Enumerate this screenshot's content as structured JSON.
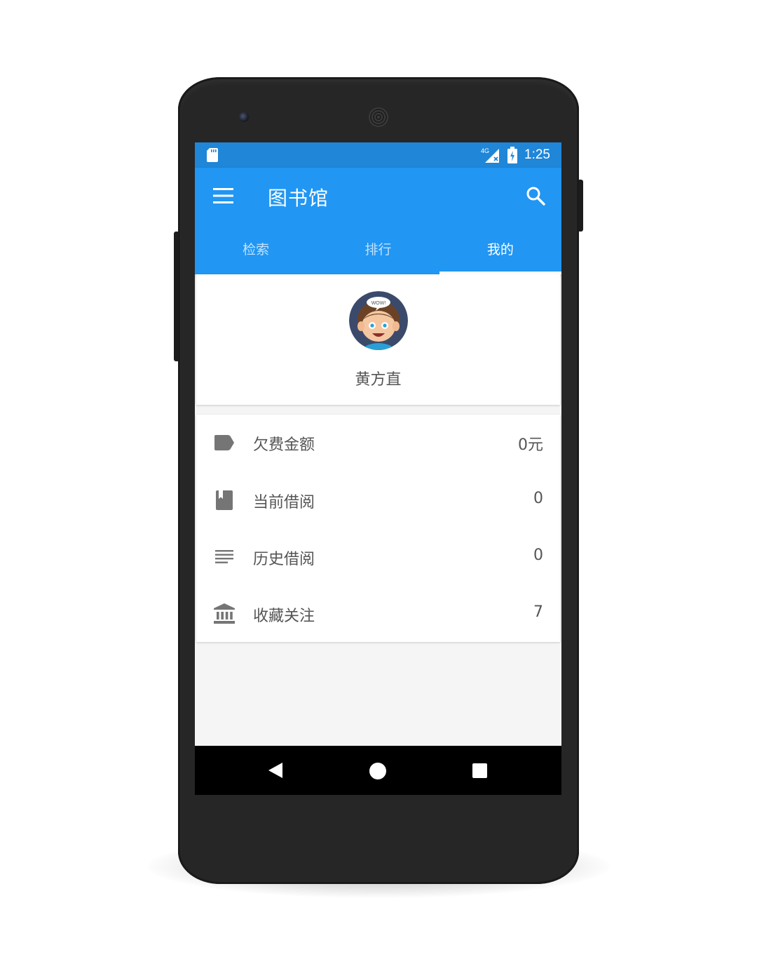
{
  "status_bar": {
    "network": "4G",
    "time": "1:25"
  },
  "app_bar": {
    "title": "图书馆",
    "menu_icon": "menu-icon",
    "search_icon": "search-icon"
  },
  "tabs": [
    {
      "label": "检索",
      "active": false
    },
    {
      "label": "排行",
      "active": false
    },
    {
      "label": "我的",
      "active": true
    }
  ],
  "profile": {
    "avatar_text": "WOW!",
    "name": "黄方直"
  },
  "stats": [
    {
      "icon": "tag-icon",
      "label": "欠费金额",
      "value": "0元"
    },
    {
      "icon": "book-icon",
      "label": "当前借阅",
      "value": "0"
    },
    {
      "icon": "list-icon",
      "label": "历史借阅",
      "value": "0"
    },
    {
      "icon": "bank-icon",
      "label": "收藏关注",
      "value": "7"
    }
  ],
  "nav_bar": {
    "back_icon": "back-icon",
    "home_icon": "home-icon",
    "recents_icon": "recents-icon"
  },
  "colors": {
    "primary": "#2196f3",
    "status_bar": "#1f86d8",
    "text_secondary": "#555555",
    "icon_grey": "#757575",
    "phone_body": "#262626"
  }
}
